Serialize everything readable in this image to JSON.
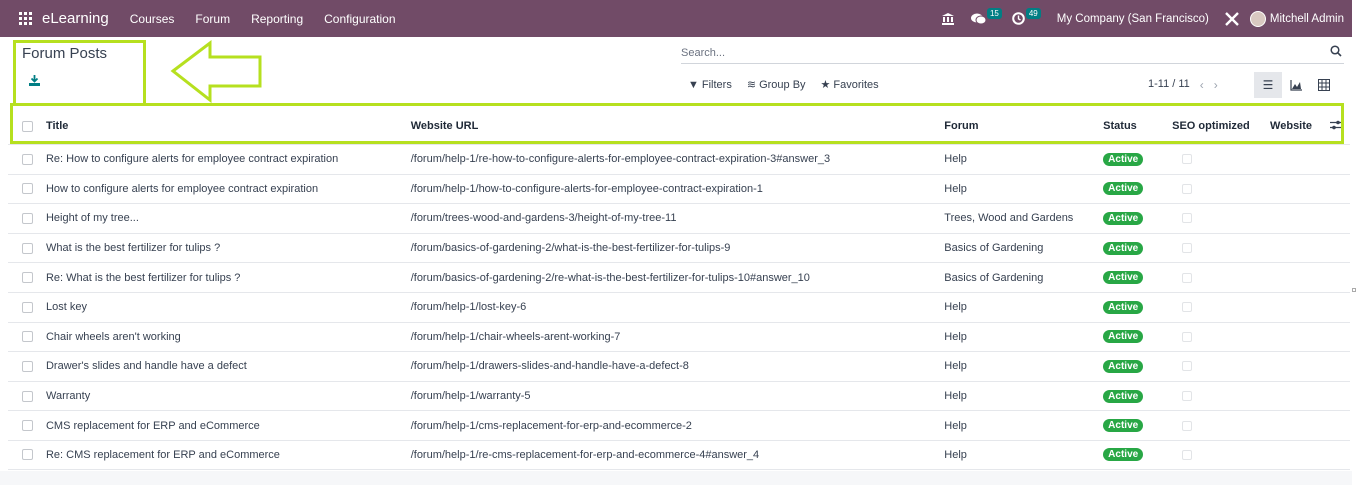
{
  "navbar": {
    "brand": "eLearning",
    "menu": [
      "Courses",
      "Forum",
      "Reporting",
      "Configuration"
    ],
    "messages_count": "15",
    "activities_count": "49",
    "company": "My Company (San Francisco)",
    "user": "Mitchell Admin",
    "bg_color": "#714b67"
  },
  "control_panel": {
    "title": "Forum Posts",
    "search_placeholder": "Search...",
    "filters_label": "Filters",
    "groupby_label": "Group By",
    "favorites_label": "Favorites",
    "pager": "1-11 / 11"
  },
  "table": {
    "headers": {
      "title": "Title",
      "url": "Website URL",
      "forum": "Forum",
      "status": "Status",
      "seo": "SEO optimized",
      "website": "Website"
    },
    "rows": [
      {
        "title": "Re: How to configure alerts for employee contract expiration",
        "url": "/forum/help-1/re-how-to-configure-alerts-for-employee-contract-expiration-3#answer_3",
        "forum": "Help",
        "status": "Active"
      },
      {
        "title": "How to configure alerts for employee contract expiration",
        "url": "/forum/help-1/how-to-configure-alerts-for-employee-contract-expiration-1",
        "forum": "Help",
        "status": "Active"
      },
      {
        "title": "Height of my tree...",
        "url": "/forum/trees-wood-and-gardens-3/height-of-my-tree-11",
        "forum": "Trees, Wood and Gardens",
        "status": "Active"
      },
      {
        "title": "What is the best fertilizer for tulips ?",
        "url": "/forum/basics-of-gardening-2/what-is-the-best-fertilizer-for-tulips-9",
        "forum": "Basics of Gardening",
        "status": "Active"
      },
      {
        "title": "Re: What is the best fertilizer for tulips ?",
        "url": "/forum/basics-of-gardening-2/re-what-is-the-best-fertilizer-for-tulips-10#answer_10",
        "forum": "Basics of Gardening",
        "status": "Active"
      },
      {
        "title": "Lost key",
        "url": "/forum/help-1/lost-key-6",
        "forum": "Help",
        "status": "Active"
      },
      {
        "title": "Chair wheels aren't working",
        "url": "/forum/help-1/chair-wheels-arent-working-7",
        "forum": "Help",
        "status": "Active"
      },
      {
        "title": "Drawer's slides and handle have a defect",
        "url": "/forum/help-1/drawers-slides-and-handle-have-a-defect-8",
        "forum": "Help",
        "status": "Active"
      },
      {
        "title": "Warranty",
        "url": "/forum/help-1/warranty-5",
        "forum": "Help",
        "status": "Active"
      },
      {
        "title": "CMS replacement for ERP and eCommerce",
        "url": "/forum/help-1/cms-replacement-for-erp-and-ecommerce-2",
        "forum": "Help",
        "status": "Active"
      },
      {
        "title": "Re: CMS replacement for ERP and eCommerce",
        "url": "/forum/help-1/re-cms-replacement-for-erp-and-ecommerce-4#answer_4",
        "forum": "Help",
        "status": "Active"
      }
    ]
  },
  "colors": {
    "accent": "#017e84",
    "status_active": "#28a745",
    "annotation": "#b6e01f"
  }
}
